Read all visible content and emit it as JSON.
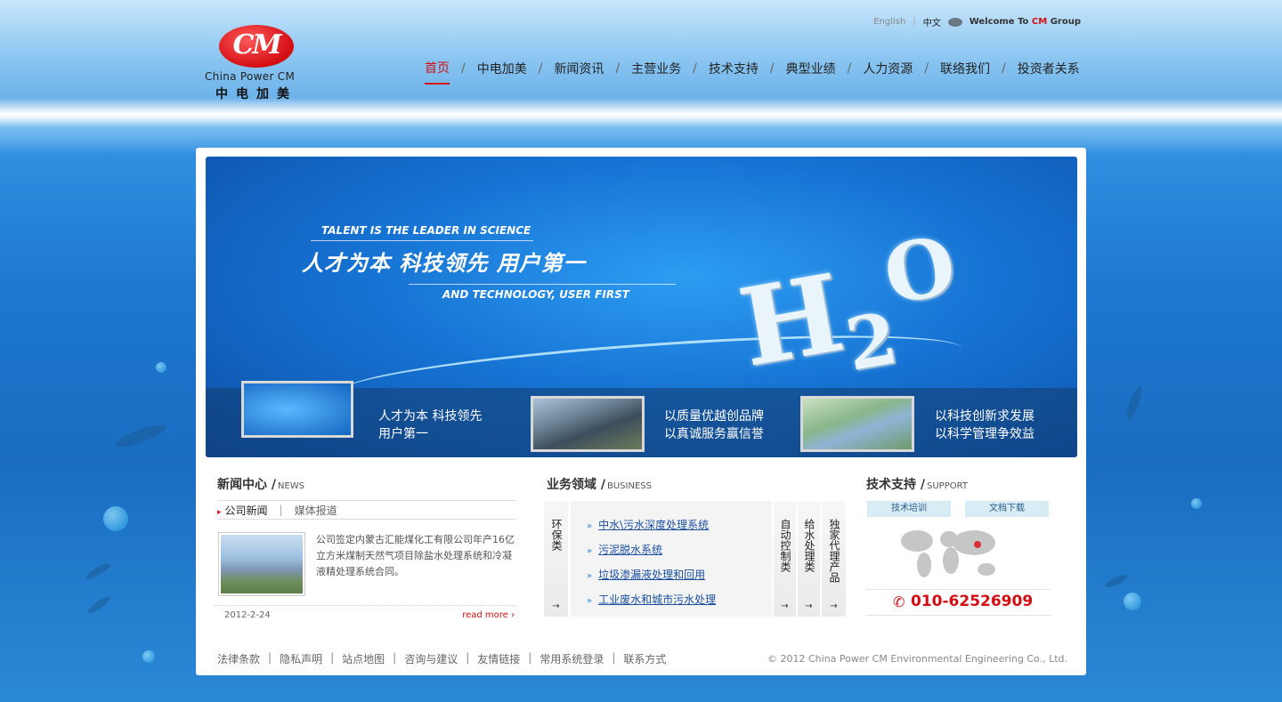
{
  "logo": {
    "en": "China Power CM",
    "cn": "中电加美",
    "mark": "CM"
  },
  "topbar": {
    "english": "English",
    "chinese": "中文",
    "welcome_prefix": "Welcome To ",
    "welcome_cm": "CM",
    "welcome_suffix": " Group"
  },
  "nav": [
    "首页",
    "中电加美",
    "新闻资讯",
    "主营业务",
    "技术支持",
    "典型业绩",
    "人力资源",
    "联络我们",
    "投资者关系"
  ],
  "banner": {
    "en1": "TALENT IS THE LEADER IN SCIENCE",
    "cn": "人才为本   科技领先   用户第一",
    "en2": "AND TECHNOLOGY, USER FIRST",
    "thumbs": [
      {
        "line1": "人才为本 科技领先",
        "line2": "用户第一"
      },
      {
        "line1": "以质量优越创品牌",
        "line2": "以真诚服务赢信誉"
      },
      {
        "line1": "以科技创新求发展",
        "line2": "以科学管理争效益"
      }
    ]
  },
  "news": {
    "title": "新闻中心 /",
    "title_en": "NEWS",
    "tabs": [
      "公司新闻",
      "媒体报道"
    ],
    "text": "公司签定内蒙古汇能煤化工有限公司年产16亿立方米煤制天然气项目除盐水处理系统和冷凝液精处理系统合同。",
    "date": "2012-2-24",
    "read_more": "read more ›"
  },
  "business": {
    "title": "业务领域 /",
    "title_en": "BUSINESS",
    "left_cat": "环保类",
    "items": [
      "中水\\污水深度处理系统",
      "污泥脱水系统",
      "垃圾渗漏液处理和回用",
      "工业废水和城市污水处理"
    ],
    "right_cats": [
      "自动控制类",
      "给水处理类",
      "独家代理产品"
    ],
    "arrow": "→"
  },
  "support": {
    "title": "技术支持 /",
    "title_en": "SUPPORT",
    "buttons": [
      "技术培训",
      "文档下载"
    ],
    "phone": "010-62526909"
  },
  "footer": {
    "links": [
      "法律条款",
      "隐私声明",
      "站点地图",
      "咨询与建议",
      "友情链接",
      "常用系统登录",
      "联系方式"
    ],
    "copyright": "© 2012 China Power CM Environmental Engineering Co., Ltd."
  },
  "colors": {
    "brand_red": "#d40d12",
    "link_blue": "#1a4fa0",
    "sea_blue": "#1e78cf"
  }
}
